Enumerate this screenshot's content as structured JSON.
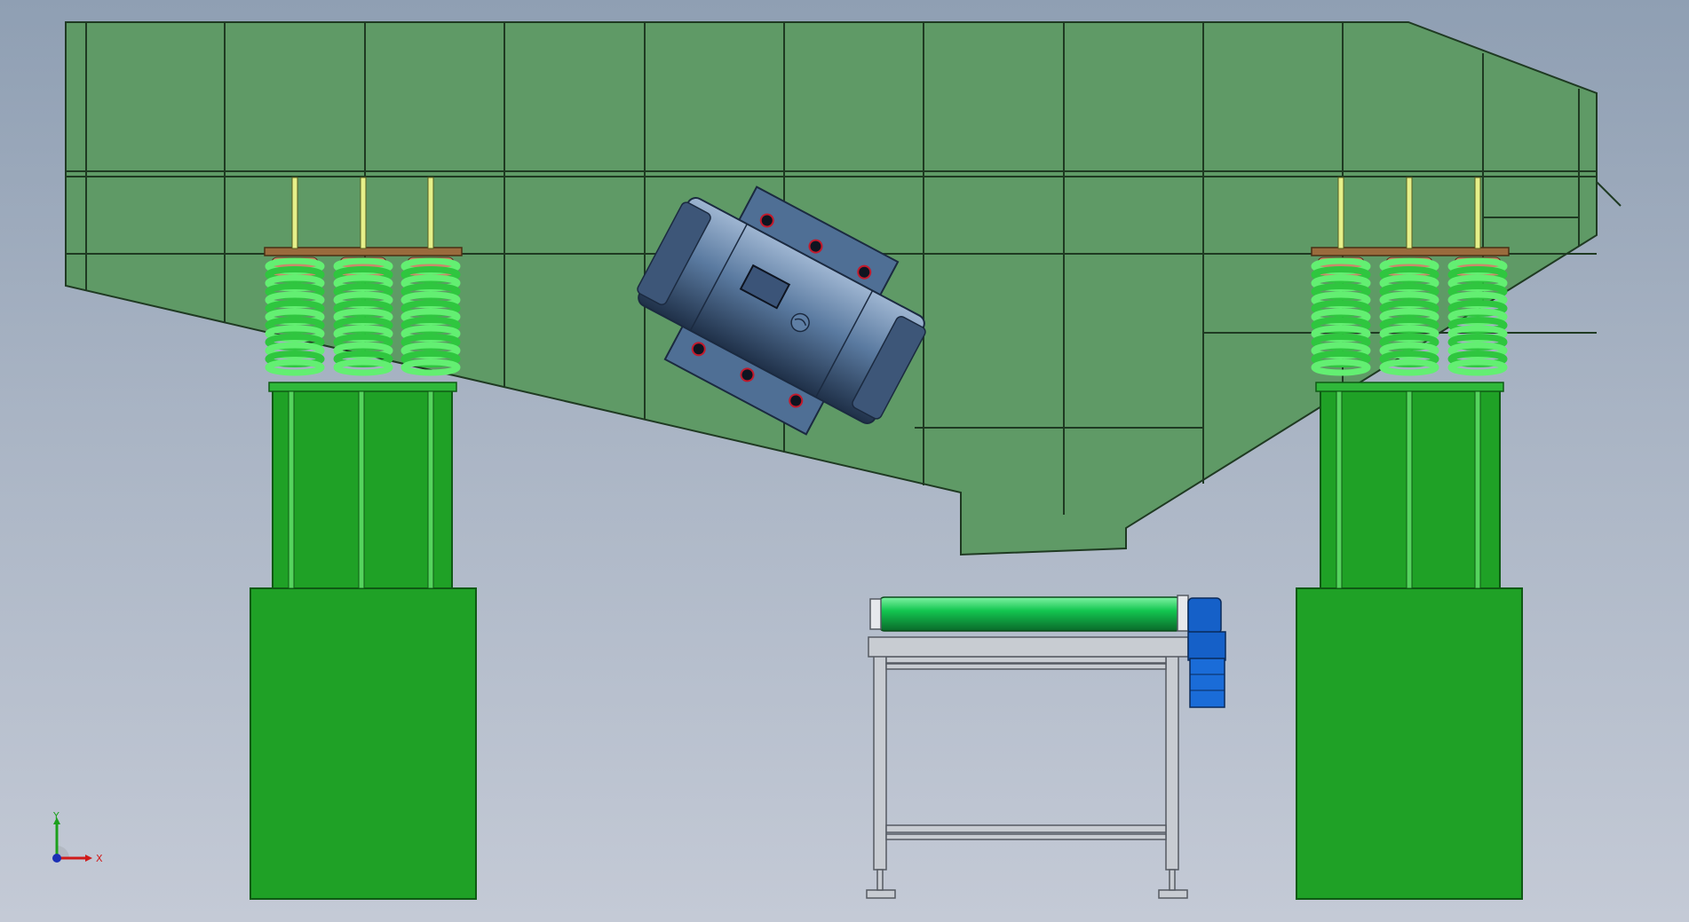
{
  "viewport": {
    "background_top": "#8f9fb3",
    "background_bottom": "#c4cad6"
  },
  "colors": {
    "screen_body": "#5f9a66",
    "screen_line": "#1f3a22",
    "support_green": "#1fa126",
    "support_edge": "#0f5a14",
    "spring_green": "#3ddc4c",
    "spring_plate": "#9a6b3d",
    "bolt_rod": "#e6f08a",
    "motor_blue": "#4f6f95",
    "motor_dark": "#2f4563",
    "roller_green": "#16c452",
    "gearmotor_blue": "#1560c8",
    "frame_grey": "#c8ccd2"
  },
  "triad": {
    "axis_y_label": "Y",
    "axis_x_label": "X",
    "axis_y_color": "#1ca01c",
    "axis_x_color": "#d01a1a",
    "origin_color": "#1a2fb5"
  },
  "icons": {
    "triad": "coordinate-triad-icon",
    "motor_logo": "motor-logo-icon"
  }
}
